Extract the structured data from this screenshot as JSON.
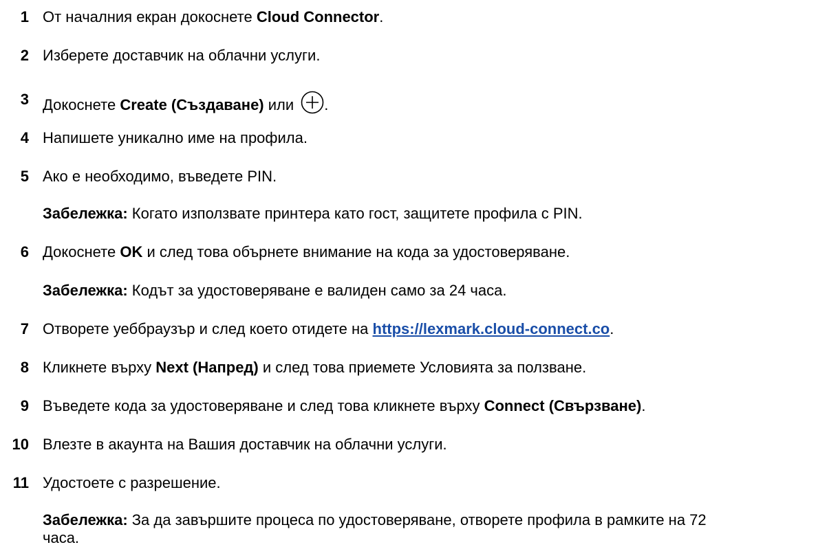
{
  "steps": [
    {
      "num": "1",
      "pre": "От началния екран докоснете ",
      "bold": "Cloud Connector",
      "post": "."
    },
    {
      "num": "2",
      "text": "Изберете доставчик на облачни услуги."
    },
    {
      "num": "3",
      "pre": "Докоснете ",
      "bold": "Create (Създаване)",
      "post": " или ",
      "icon": "plus-circle-icon",
      "end": "."
    },
    {
      "num": "4",
      "text": "Напишете уникално име на профила."
    },
    {
      "num": "5",
      "text": "Ако е необходимо, въведете PIN."
    },
    {
      "num": "6",
      "pre": "Докоснете ",
      "bold": "OK",
      "post": " и след това обърнете внимание на кода за удостоверяване."
    },
    {
      "num": "7",
      "pre": "Отворете уеббраузър и след което отидете на ",
      "link": "https://lexmark.cloud-connect.co",
      "post": "."
    },
    {
      "num": "8",
      "pre": "Кликнете върху ",
      "bold": "Next (Напред)",
      "post": " и след това приемете Условията за ползване."
    },
    {
      "num": "9",
      "pre": "Въведете кода за удостоверяване и след това кликнете върху ",
      "bold": "Connect (Свързване)",
      "post": "."
    },
    {
      "num": "10",
      "text": "Влезте в акаунта на Вашия доставчик на облачни услуги."
    },
    {
      "num": "11",
      "text": "Удостоете с разрешение."
    }
  ],
  "notes": {
    "label": "Забележка:",
    "note5": " Когато използвате принтера като гост, защитете профила с PIN.",
    "note6": " Кодът за удостоверяване е валиден само за 24 часа.",
    "note11_line1": " За да завършите процеса по удостоверяване, отворете профила в рамките на 72",
    "note11_line2": "часа."
  }
}
